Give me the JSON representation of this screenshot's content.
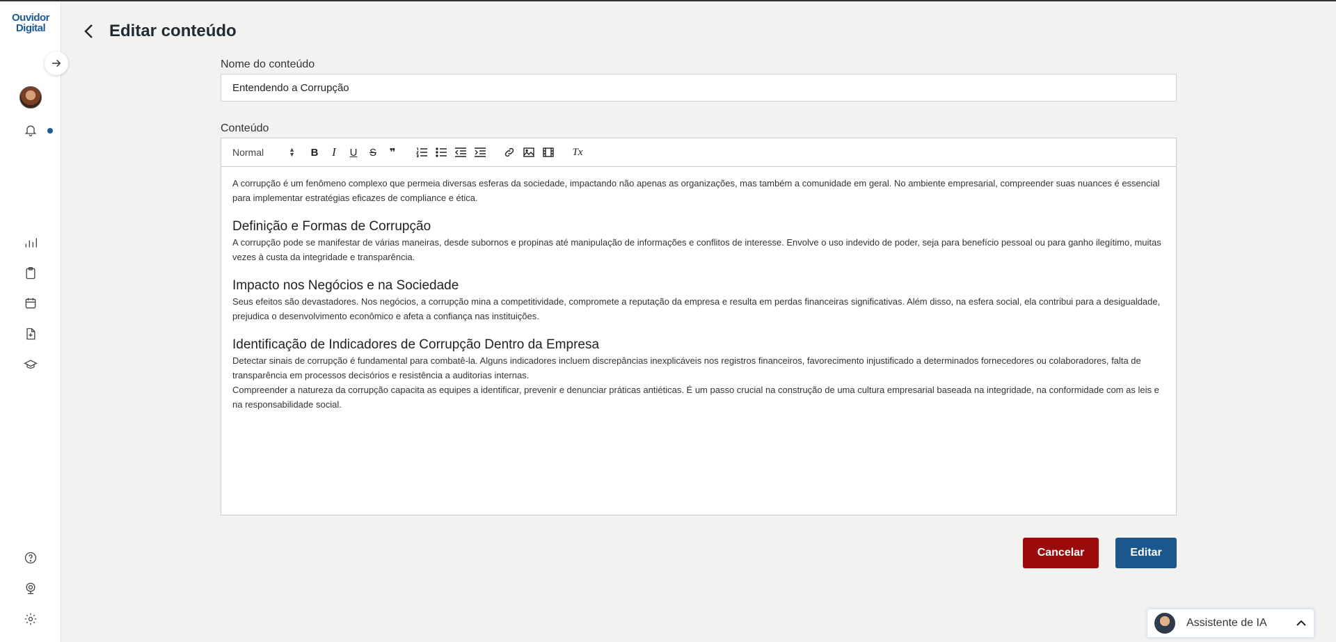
{
  "app": {
    "logo_line1": "Ouvidor",
    "logo_line2": "Digital"
  },
  "header": {
    "title": "Editar conteúdo"
  },
  "sidebar": {
    "items": [
      "chart-icon",
      "clipboard-icon",
      "calendar-icon",
      "file-plus-icon",
      "graduation-cap-icon"
    ],
    "bottom_items": [
      "help-icon",
      "webcam-icon",
      "gear-icon"
    ]
  },
  "form": {
    "name_label": "Nome do conteúdo",
    "name_value": "Entendendo a Corrupção",
    "content_label": "Conteúdo"
  },
  "editor": {
    "format_select": "Normal",
    "toolbar": [
      "bold",
      "italic",
      "underline",
      "strike",
      "blockquote",
      "ordered-list",
      "bullet-list",
      "outdent",
      "indent",
      "link",
      "image",
      "video",
      "clear-format"
    ],
    "toolbar_glyphs": {
      "bold": "B",
      "italic": "I",
      "underline": "U",
      "strike": "S",
      "blockquote": "❞",
      "clear": "Tx"
    },
    "intro": "A corrupção é um fenômeno complexo que permeia diversas esferas da sociedade, impactando não apenas as organizações, mas também a comunidade em geral. No ambiente empresarial, compreender suas nuances é essencial para implementar estratégias eficazes de compliance e ética.",
    "sections": [
      {
        "heading": "Definição e Formas de Corrupção",
        "paragraphs": [
          "A corrupção pode se manifestar de várias maneiras, desde subornos e propinas até manipulação de informações e conflitos de interesse. Envolve o uso indevido de poder, seja para benefício pessoal ou para ganho ilegítimo, muitas vezes à custa da integridade e transparência."
        ]
      },
      {
        "heading": "Impacto nos Negócios e na Sociedade",
        "paragraphs": [
          "Seus efeitos são devastadores. Nos negócios, a corrupção mina a competitividade, compromete a reputação da empresa e resulta em perdas financeiras significativas. Além disso, na esfera social, ela contribui para a desigualdade, prejudica o desenvolvimento econômico e afeta a confiança nas instituições."
        ]
      },
      {
        "heading": "Identificação de Indicadores de Corrupção Dentro da Empresa",
        "paragraphs": [
          "Detectar sinais de corrupção é fundamental para combatê-la. Alguns indicadores incluem discrepâncias inexplicáveis nos registros financeiros, favorecimento injustificado a determinados fornecedores ou colaboradores, falta de transparência em processos decisórios e resistência a auditorias internas.",
          "Compreender a natureza da corrupção capacita as equipes a identificar, prevenir e denunciar práticas antiéticas. É um passo crucial na construção de uma cultura empresarial baseada na integridade, na conformidade com as leis e na responsabilidade social."
        ]
      }
    ]
  },
  "actions": {
    "cancel_label": "Cancelar",
    "edit_label": "Editar"
  },
  "assistant": {
    "label": "Assistente de IA"
  },
  "colors": {
    "brand": "#1d5b96",
    "cancel": "#9b0b0b",
    "primary": "#1b578e"
  }
}
